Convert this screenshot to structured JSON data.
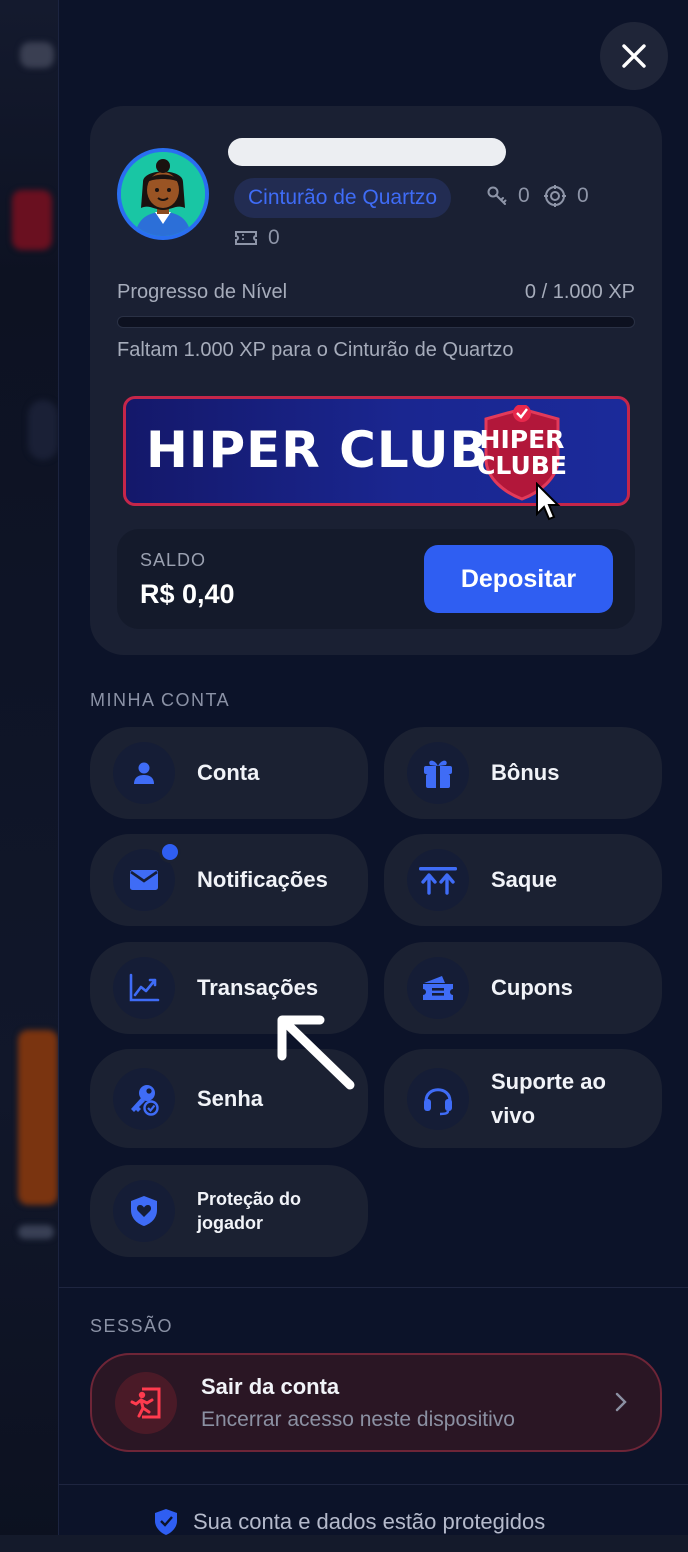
{
  "header": {
    "close_icon": "close-icon"
  },
  "profile": {
    "rank": "Cinturão de Quartzo",
    "keys": "0",
    "coins": "0",
    "tickets": "0",
    "progress_label": "Progresso de Nível",
    "progress_value": "0 / 1.000 XP",
    "progress_fraction": 0,
    "progress_hint": "Faltam 1.000 XP para o Cinturão de Quartzo",
    "banner_title": "HIPER CLUBE",
    "banner_badge_line1": "HIPER",
    "banner_badge_line2": "CLUBE",
    "balance_label": "SALDO",
    "balance_value": "R$ 0,40",
    "deposit_label": "Depositar"
  },
  "account": {
    "section_title": "MINHA CONTA",
    "items": [
      {
        "label": "Conta",
        "icon": "user-icon"
      },
      {
        "label": "Bônus",
        "icon": "gift-icon"
      },
      {
        "label": "Notificações",
        "icon": "mail-icon"
      },
      {
        "label": "Saque",
        "icon": "withdraw-icon"
      },
      {
        "label": "Transações",
        "icon": "chart-icon"
      },
      {
        "label": "Cupons",
        "icon": "coupon-icon"
      },
      {
        "label": "Senha",
        "icon": "key-icon"
      },
      {
        "label": "Suporte ao vivo",
        "icon": "headset-icon"
      },
      {
        "label": "Proteção do jogador",
        "icon": "shield-heart-icon"
      }
    ]
  },
  "session": {
    "section_title": "SESSÃO",
    "logout_title": "Sair da conta",
    "logout_subtitle": "Encerrar acesso neste dispositivo"
  },
  "footer": {
    "note": "Sua conta e dados estão protegidos"
  },
  "colors": {
    "accent": "#2f5ef2",
    "danger": "#c5264a",
    "background": "#0c1329",
    "card": "#1a2033"
  }
}
